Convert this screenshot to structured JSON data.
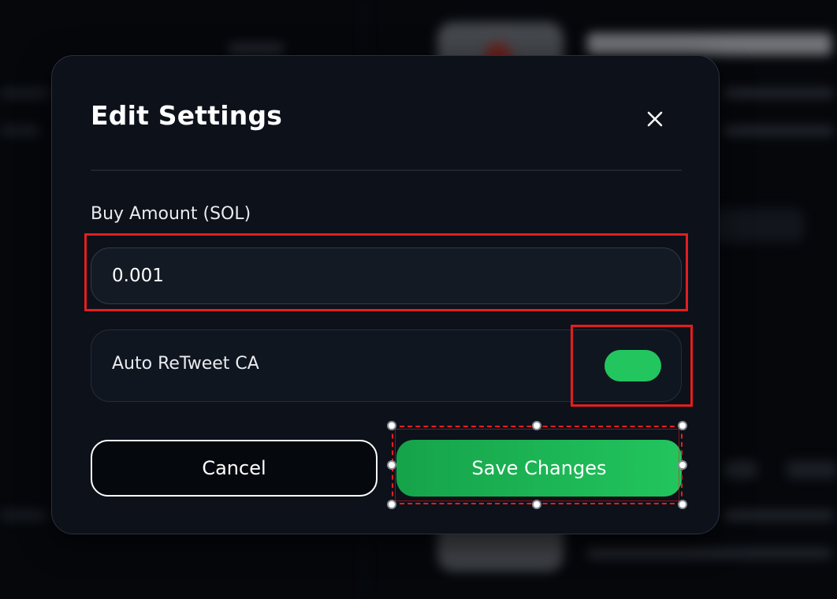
{
  "dialog": {
    "title": "Edit Settings",
    "close_icon": "close-icon",
    "buy_amount": {
      "label": "Buy Amount (SOL)",
      "value": "0.001"
    },
    "auto_retweet": {
      "label": "Auto ReTweet CA",
      "enabled": true
    },
    "buttons": {
      "cancel_label": "Cancel",
      "save_label": "Save Changes"
    }
  },
  "colors": {
    "accent_green": "#22c55e",
    "accent_green_dark": "#16a34a",
    "annotation_red": "#e31e1e",
    "modal_bg": "#0c111a"
  }
}
